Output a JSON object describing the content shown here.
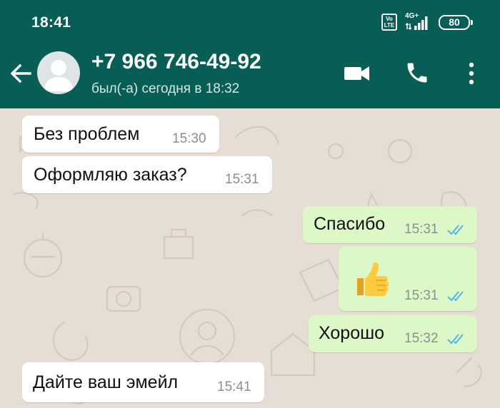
{
  "status_bar": {
    "time": "18:41",
    "volte_line1": "Vo",
    "volte_line2": "LTE",
    "network": "4G+",
    "battery": "80"
  },
  "header": {
    "contact_name": "+7 966 746-49-92",
    "last_seen": "был(-а) сегодня в 18:32",
    "actions": [
      "back-arrow",
      "video-call",
      "voice-call",
      "more-options"
    ]
  },
  "messages": [
    {
      "direction": "incoming",
      "text": "Без проблем",
      "time": "15:30"
    },
    {
      "direction": "incoming",
      "text": "Оформляю заказ?",
      "time": "15:31"
    },
    {
      "direction": "outgoing",
      "text": "Спасибо",
      "time": "15:31",
      "status": "read"
    },
    {
      "direction": "outgoing",
      "emoji": "thumbs-up",
      "time": "15:31",
      "status": "read"
    },
    {
      "direction": "outgoing",
      "text": "Хорошо",
      "time": "15:32",
      "status": "read"
    },
    {
      "direction": "incoming",
      "text": "Дайте ваш эмейл",
      "time": "15:41"
    }
  ],
  "colors": {
    "header_bg": "#075e55",
    "chat_bg": "#e6ddd4",
    "incoming_bubble": "#ffffff",
    "outgoing_bubble": "#dcf8c6",
    "read_ticks": "#4fb6ec"
  }
}
